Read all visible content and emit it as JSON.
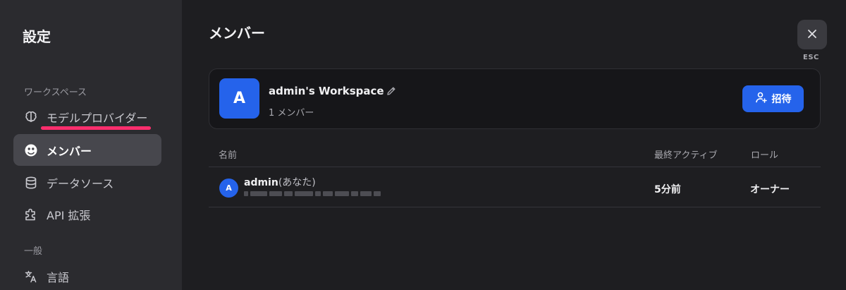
{
  "sidebar": {
    "title": "設定",
    "workspace_section": "ワークスペース",
    "general_section": "一般",
    "items": [
      {
        "label": "モデルプロバイダー",
        "icon": "brain-icon",
        "active": false
      },
      {
        "label": "メンバー",
        "icon": "members-icon",
        "active": true
      },
      {
        "label": "データソース",
        "icon": "database-icon",
        "active": false
      },
      {
        "label": "API 拡張",
        "icon": "puzzle-icon",
        "active": false
      },
      {
        "label": "言語",
        "icon": "translate-icon",
        "active": false
      }
    ],
    "highlight_color": "#ff2e6d"
  },
  "main": {
    "title": "メンバー",
    "close_label": "ESC",
    "workspace": {
      "avatar_letter": "A",
      "name": "admin's Workspace",
      "member_count": "1 メンバー",
      "invite_label": "招待"
    },
    "table": {
      "headers": {
        "name": "名前",
        "last_active": "最終アクティブ",
        "role": "ロール"
      },
      "rows": [
        {
          "avatar_letter": "A",
          "name": "admin",
          "you_tag": "(あなた)",
          "last_active": "5分前",
          "role": "オーナー"
        }
      ]
    }
  },
  "colors": {
    "accent": "#2563eb",
    "background": "#1e1e21",
    "sidebar": "#2b2b2f"
  }
}
